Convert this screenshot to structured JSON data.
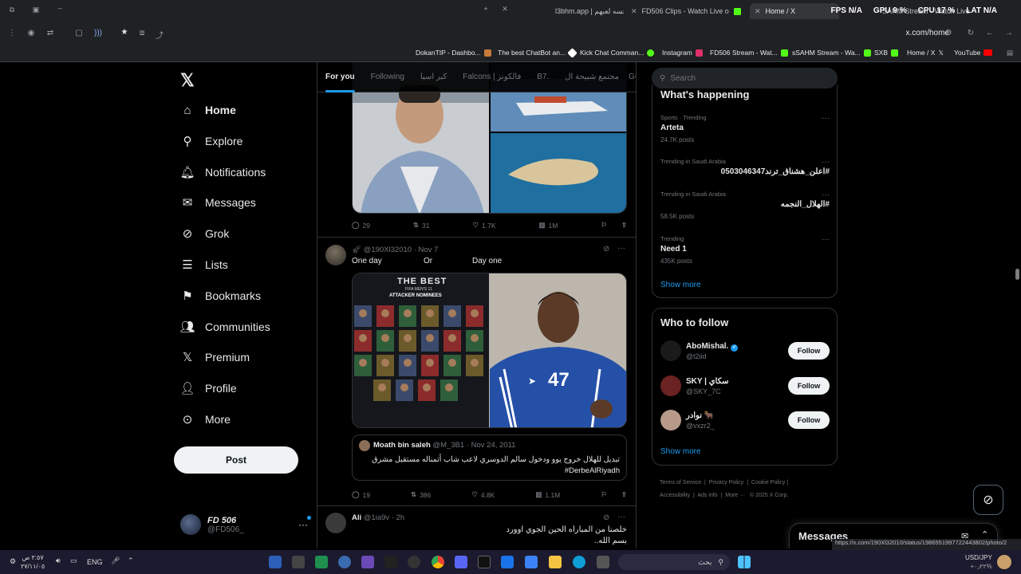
{
  "browser": {
    "tabs": [
      {
        "label": "l3bhm.app | نحسه لعبهم",
        "active": false
      },
      {
        "label": "FD506 Clips - Watch Live on Ki",
        "active": false
      },
      {
        "label": "Home / X",
        "active": true
      },
      {
        "label": "SAHM Stream - Watch Live",
        "active": false
      }
    ],
    "overlay": {
      "fps": "FPS N/A",
      "gpu": "GPU 9 %",
      "cpu": "CPU 17 %",
      "lat": "LAT N/A"
    },
    "url": "x.com/home",
    "bookmarks": [
      {
        "label": "DokanTIP - Dashbo...",
        "color": "#c77b3a"
      },
      {
        "label": "The best ChatBot an...",
        "color": "#ffffff"
      },
      {
        "label": "Kick Chat Comman...",
        "color": "#53fc18"
      },
      {
        "label": "Instagram",
        "color": "#e1306c"
      },
      {
        "label": "FD506 Stream - Wat...",
        "color": "#53fc18"
      },
      {
        "label": "sSAHM Stream - Wa...",
        "color": "#53fc18"
      },
      {
        "label": "SXB",
        "color": "#53fc18"
      },
      {
        "label": "Home / X",
        "color": "#ffffff"
      },
      {
        "label": "YouTube",
        "color": "#ff0000"
      }
    ],
    "status_url": "https://x.com/190Xl32010/status/1986551997722443802/photo/2"
  },
  "nav": {
    "items": [
      {
        "label": "Home",
        "icon": "home-icon",
        "glyph": "⌂"
      },
      {
        "label": "Explore",
        "icon": "search-icon",
        "glyph": "⚲"
      },
      {
        "label": "Notifications",
        "icon": "bell-icon",
        "glyph": "🔔︎"
      },
      {
        "label": "Messages",
        "icon": "mail-icon",
        "glyph": "✉"
      },
      {
        "label": "Grok",
        "icon": "grok-icon",
        "glyph": "⊘"
      },
      {
        "label": "Lists",
        "icon": "lists-icon",
        "glyph": "☰"
      },
      {
        "label": "Bookmarks",
        "icon": "bookmark-icon",
        "glyph": "⚑"
      },
      {
        "label": "Communities",
        "icon": "communities-icon",
        "glyph": "👥︎"
      },
      {
        "label": "Premium",
        "icon": "x-logo-icon",
        "glyph": "𝕏"
      },
      {
        "label": "Profile",
        "icon": "person-icon",
        "glyph": "👤︎"
      },
      {
        "label": "More",
        "icon": "more-circle-icon",
        "glyph": "⊙"
      }
    ],
    "post_label": "Post",
    "account": {
      "name": "FD 506",
      "handle": "@FD506_"
    }
  },
  "timeline": {
    "tabs": [
      "For you",
      "Following",
      "كبر اسيا",
      "Falcons | فالكونز",
      "B7.",
      "مجتمع شبيحة ال",
      "GC"
    ],
    "tweet1": {
      "replies": "29",
      "reposts": "31",
      "likes": "1.7K",
      "views": "1M"
    },
    "tweet2": {
      "handle": "@190Xl32010",
      "date": "· Nov 7",
      "text_a": "One day",
      "text_b": "Or",
      "text_c": "Day one",
      "quote_name": "Moath bin saleh",
      "quote_handle": "@M_3B1",
      "quote_date": "· Nov 24, 2011",
      "quote_text": "تبديل للهلال خروج يوو ودخول سالم الدوسري لاعب شاب أتمناله مستقبل مشرق",
      "quote_tag": "#DerbeAlRiyadh",
      "poster_title": "THE BEST",
      "poster_sub": "FIFA MEN'S 11",
      "poster_line": "ATTACKER NOMINEES",
      "jersey_number": "47",
      "replies": "19",
      "reposts": "386",
      "likes": "4.8K",
      "views": "1.1M"
    },
    "tweet3": {
      "name": "Ali",
      "handle": "@1ia9v",
      "date": "· 2h",
      "line1": "خلصنا من المباراه الحين الجوي اوورد",
      "line2": "بسم الله.."
    }
  },
  "right": {
    "search_placeholder": "Search",
    "happening_title": "What's happening",
    "trends": [
      {
        "category": "Sports · Trending",
        "name": "Arteta",
        "count": "24.7K posts"
      },
      {
        "category": "Trending in Saudi Arabia",
        "name": "#اعلن_هشناق_ترند0503046347",
        "count": ""
      },
      {
        "category": "Trending in Saudi Arabia",
        "name": "#الهلال_النجمه",
        "count": "58.5K posts"
      },
      {
        "category": "Trending",
        "name": "Need 1",
        "count": "435K posts"
      }
    ],
    "show_more": "Show more",
    "follow_title": "Who to follow",
    "follow": [
      {
        "name": "AboMishal.",
        "handle": "@t2iid",
        "verified": true,
        "btn": "Follow"
      },
      {
        "name": "SKY | سكاي",
        "handle": "@SKY_7C",
        "verified": false,
        "btn": "Follow"
      },
      {
        "name": "نوادر 🐂",
        "handle": "@vxzr2_",
        "verified": false,
        "btn": "Follow"
      }
    ],
    "follow_show_more": "Show more",
    "footer": {
      "l1": "Terms of Service",
      "l2": "Privacy Policy",
      "l3": "Cookie Policy",
      "l4": "Accessibility",
      "l5": "Ads info",
      "l6": "More ···",
      "l7": "© 2025 X Corp."
    },
    "messages_label": "Messages"
  },
  "taskbar": {
    "time": "٢:٥٧ ص",
    "date": "٢٧/١١/٠٥",
    "lang": "ENG",
    "search_label": "بحث",
    "currency": "USD/JPY",
    "currency_change": "+٠٫٢٢%"
  }
}
